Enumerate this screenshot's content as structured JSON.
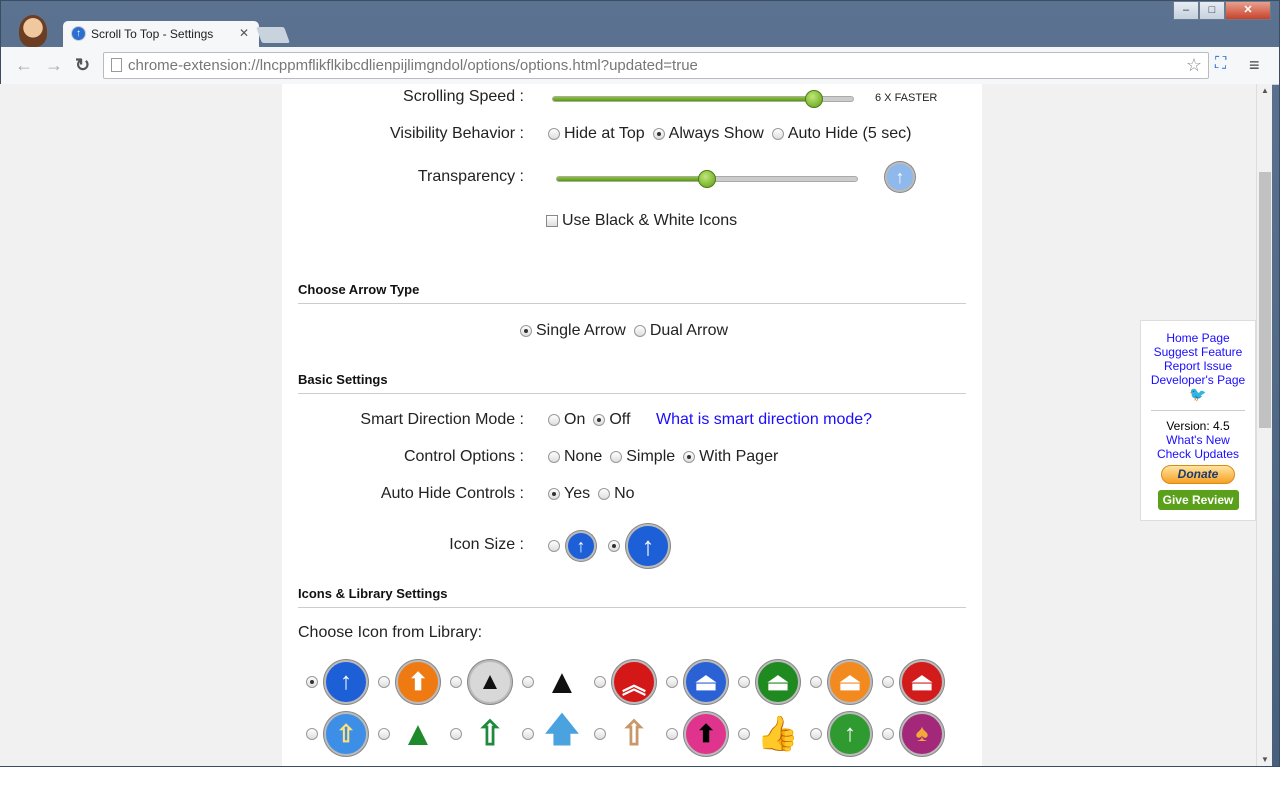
{
  "browser": {
    "tab_title": "Scroll To Top - Settings",
    "url": "chrome-extension://lncppmflikflkibcdlienpijlimgndol/options/options.html?updated=true"
  },
  "settings": {
    "scrolling_speed": {
      "label": "Scrolling Speed :",
      "value_fraction": 0.87,
      "value_text": "6 X FASTER"
    },
    "visibility": {
      "label": "Visibility Behavior :",
      "options": [
        "Hide at Top",
        "Always Show",
        "Auto Hide (5 sec)"
      ],
      "selected": 1
    },
    "transparency": {
      "label": "Transparency :",
      "value_fraction": 0.5
    },
    "bw_icons": {
      "label": "Use Black & White Icons",
      "checked": false
    }
  },
  "arrow_type": {
    "title": "Choose Arrow Type",
    "options": [
      "Single Arrow",
      "Dual Arrow"
    ],
    "selected": 0
  },
  "basic": {
    "title": "Basic Settings",
    "smart_direction": {
      "label": "Smart Direction Mode :",
      "options": [
        "On",
        "Off"
      ],
      "selected": 1,
      "help_link": "What is smart direction mode?"
    },
    "control_options": {
      "label": "Control Options :",
      "options": [
        "None",
        "Simple",
        "With Pager"
      ],
      "selected": 2
    },
    "auto_hide_controls": {
      "label": "Auto Hide Controls :",
      "options": [
        "Yes",
        "No"
      ],
      "selected": 0
    },
    "icon_size": {
      "label": "Icon Size :",
      "selected": 1
    }
  },
  "library": {
    "title": "Icons & Library Settings",
    "prompt": "Choose Icon from Library:",
    "selected": 0,
    "icons": [
      {
        "name": "blue-arrow",
        "bg": "#1d5fd6",
        "glyph": "↑",
        "fg": "#fff"
      },
      {
        "name": "orange-arrow",
        "bg": "#f07a12",
        "glyph": "⬆",
        "fg": "#fff"
      },
      {
        "name": "silver-double-triangle",
        "bg": "#d8d8d8",
        "glyph": "▲",
        "fg": "#111"
      },
      {
        "name": "ring-double-triangle",
        "bg": "#fff",
        "glyph": "▲",
        "fg": "#111"
      },
      {
        "name": "red-double-chevron",
        "bg": "#d41818",
        "glyph": "︽",
        "fg": "#fff"
      },
      {
        "name": "blue-eject",
        "bg": "#2a62d6",
        "glyph": "⏏",
        "fg": "#fff"
      },
      {
        "name": "green-eject",
        "bg": "#1f8a1f",
        "glyph": "⏏",
        "fg": "#fff"
      },
      {
        "name": "orange-eject",
        "bg": "#f28a20",
        "glyph": "⏏",
        "fg": "#fff"
      },
      {
        "name": "red-eject",
        "bg": "#d21c1c",
        "glyph": "⏏",
        "fg": "#fff"
      },
      {
        "name": "yellow-arrow-blue",
        "bg": "#3c8ee6",
        "glyph": "⇧",
        "fg": "#ffe27a"
      },
      {
        "name": "green-tree-arrow",
        "bg": "#fff",
        "glyph": "▲",
        "fg": "#1f8a2c"
      },
      {
        "name": "green-outline-arrow",
        "bg": "#fff",
        "glyph": "⇧",
        "fg": "#1f8a3c"
      },
      {
        "name": "light-blue-arrow",
        "bg": "#fff",
        "glyph": "🡅",
        "fg": "#4aa3df"
      },
      {
        "name": "beige-arrow",
        "bg": "#fff",
        "glyph": "⇧",
        "fg": "#c9986a"
      },
      {
        "name": "pink-black-arrow",
        "bg": "#e0338e",
        "glyph": "⬆",
        "fg": "#000"
      },
      {
        "name": "thumbs-up",
        "bg": "#fff",
        "glyph": "👍",
        "fg": "#f2b41a"
      },
      {
        "name": "green-circle-arrow",
        "bg": "#2f9a2f",
        "glyph": "↑",
        "fg": "#fff"
      },
      {
        "name": "purple-heart",
        "bg": "#a3287a",
        "glyph": "♠",
        "fg": "#f2a93a"
      }
    ]
  },
  "sidebar": {
    "links": [
      "Home Page",
      "Suggest Feature",
      "Report Issue",
      "Developer's Page"
    ],
    "version": "Version: 4.5",
    "whats_new": "What's New",
    "check_updates": "Check Updates",
    "donate": "Donate",
    "review": "Give Review"
  }
}
